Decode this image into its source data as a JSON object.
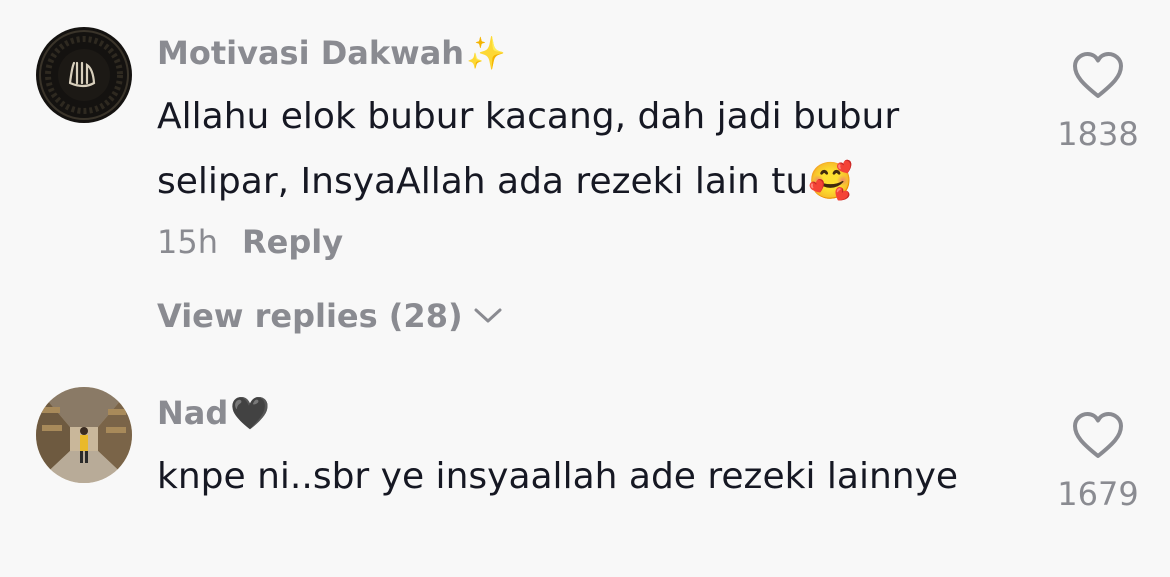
{
  "comments": [
    {
      "username": "Motivasi Dakwah",
      "username_emoji": "✨",
      "text": "Allahu elok bubur kacang, dah jadi bubur selipar, InsyaAllah ada rezeki lain tu",
      "text_emoji": "🥰",
      "time": "15h",
      "reply_label": "Reply",
      "view_replies_label": "View replies (28)",
      "likes": "1838",
      "avatar": "allah-calligraphy-avatar"
    },
    {
      "username": "Nad",
      "username_emoji": "🖤",
      "text": "knpe ni..sbr ye insyaallah ade rezeki lainnye",
      "likes": "1679",
      "avatar": "warehouse-person-avatar"
    }
  ],
  "colors": {
    "background": "#f8f8f8",
    "primary_text": "#161823",
    "secondary_text": "#8a8b91"
  }
}
